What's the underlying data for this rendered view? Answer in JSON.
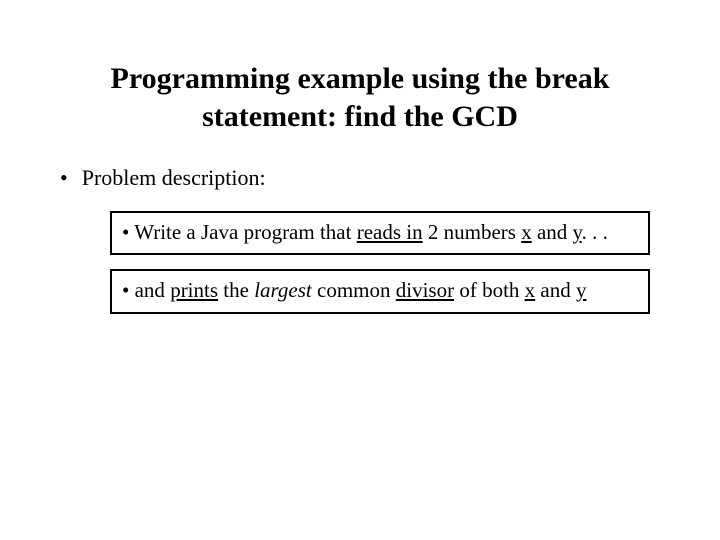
{
  "title_line1": "Programming example using the break",
  "title_line2": "statement: find the GCD",
  "bullet_label": "Problem description:",
  "box1": {
    "pre": "• Write a Java program that ",
    "reads_in": "reads in",
    "mid1": " 2 numbers ",
    "x": "x",
    "mid2": " and ",
    "y": "y",
    "tail": ". . ."
  },
  "box2": {
    "pre": "• and ",
    "prints": "prints",
    "mid1": " the ",
    "largest": "largest",
    "mid2": " common ",
    "divisor": "divisor",
    "mid3": " of both ",
    "x": "x",
    "mid4": " and ",
    "y": "y"
  }
}
